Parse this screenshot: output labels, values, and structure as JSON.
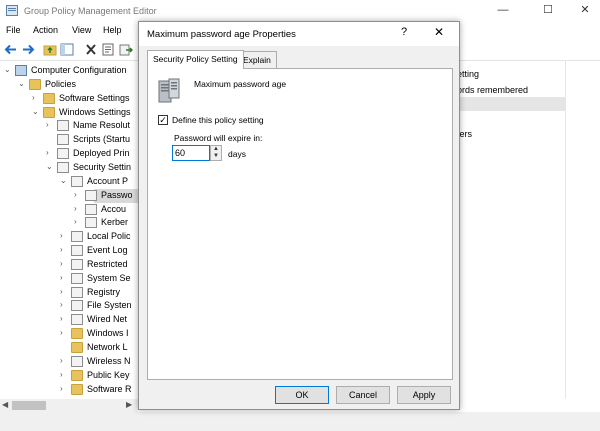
{
  "main_window": {
    "title": "Group Policy Management Editor",
    "controls": {
      "minimize": "—",
      "maximize": "☐",
      "close": "✕"
    }
  },
  "menu": [
    "File",
    "Action",
    "View",
    "Help"
  ],
  "toolbar_icons": [
    "back-arrow-icon",
    "forward-arrow-icon",
    "up-folder-icon",
    "show-tree-icon",
    "delete-icon",
    "properties-icon",
    "export-icon"
  ],
  "tree": {
    "items": [
      {
        "label": "Computer Configuration",
        "indent": 0,
        "expander": "open",
        "icon": "computer"
      },
      {
        "label": "Policies",
        "indent": 1,
        "expander": "open",
        "icon": "folder"
      },
      {
        "label": "Software Settings",
        "indent": 2,
        "expander": "closed",
        "icon": "folder"
      },
      {
        "label": "Windows Settings",
        "indent": 2,
        "expander": "open",
        "icon": "folder"
      },
      {
        "label": "Name Resolut",
        "indent": 3,
        "expander": "closed",
        "icon": "doc"
      },
      {
        "label": "Scripts (Startu",
        "indent": 3,
        "expander": "",
        "icon": "doc"
      },
      {
        "label": "Deployed Prin",
        "indent": 3,
        "expander": "closed",
        "icon": "doc"
      },
      {
        "label": "Security Settin",
        "indent": 3,
        "expander": "open",
        "icon": "doc"
      },
      {
        "label": "Account P",
        "indent": 4,
        "expander": "open",
        "icon": "doc"
      },
      {
        "label": "Passwo",
        "indent": 5,
        "expander": "closed",
        "icon": "doc",
        "selected": true
      },
      {
        "label": "Accou",
        "indent": 5,
        "expander": "closed",
        "icon": "doc"
      },
      {
        "label": "Kerber",
        "indent": 5,
        "expander": "closed",
        "icon": "doc"
      },
      {
        "label": "Local Polic",
        "indent": 4,
        "expander": "closed",
        "icon": "doc"
      },
      {
        "label": "Event Log",
        "indent": 4,
        "expander": "closed",
        "icon": "doc"
      },
      {
        "label": "Restricted",
        "indent": 4,
        "expander": "closed",
        "icon": "doc"
      },
      {
        "label": "System Se",
        "indent": 4,
        "expander": "closed",
        "icon": "doc"
      },
      {
        "label": "Registry",
        "indent": 4,
        "expander": "closed",
        "icon": "doc"
      },
      {
        "label": "File Systen",
        "indent": 4,
        "expander": "closed",
        "icon": "doc"
      },
      {
        "label": "Wired Net",
        "indent": 4,
        "expander": "closed",
        "icon": "doc"
      },
      {
        "label": "Windows I",
        "indent": 4,
        "expander": "closed",
        "icon": "folder"
      },
      {
        "label": "Network L",
        "indent": 4,
        "expander": "",
        "icon": "folder"
      },
      {
        "label": "Wireless N",
        "indent": 4,
        "expander": "closed",
        "icon": "doc"
      },
      {
        "label": "Public Key",
        "indent": 4,
        "expander": "closed",
        "icon": "folder"
      },
      {
        "label": "Software R",
        "indent": 4,
        "expander": "closed",
        "icon": "folder"
      }
    ]
  },
  "right_pane": {
    "header": "etting",
    "row1": "ords remembered",
    "row3": "ters"
  },
  "dialog": {
    "title": "Maximum password age Properties",
    "help": "?",
    "close": "✕",
    "tabs": [
      "Security Policy Setting",
      "Explain"
    ],
    "policy_name": "Maximum password age",
    "define_label": "Define this policy setting",
    "define_checked": true,
    "expire_label": "Password will expire in:",
    "expire_value": "60",
    "unit": "days",
    "buttons": {
      "ok": "OK",
      "cancel": "Cancel",
      "apply": "Apply"
    }
  }
}
